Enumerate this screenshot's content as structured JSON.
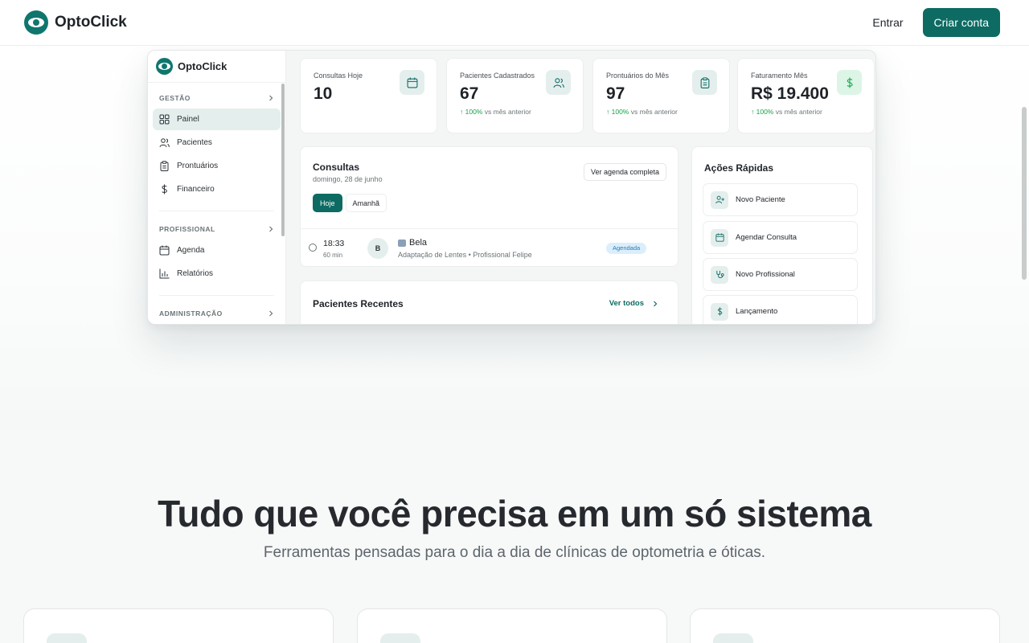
{
  "nav": {
    "brand": "OptoClick",
    "login_label": "Entrar",
    "signup_label": "Criar conta"
  },
  "app": {
    "brand": "OptoClick",
    "sidebar": {
      "sections": [
        {
          "title": "GESTÃO",
          "items": [
            {
              "label": "Painel",
              "icon": "grid-icon",
              "active": true
            },
            {
              "label": "Pacientes",
              "icon": "users-icon"
            },
            {
              "label": "Prontuários",
              "icon": "clipboard-icon"
            },
            {
              "label": "Financeiro",
              "icon": "dollar-icon"
            }
          ]
        },
        {
          "title": "PROFISSIONAL",
          "items": [
            {
              "label": "Agenda",
              "icon": "calendar-icon"
            },
            {
              "label": "Relatórios",
              "icon": "bar-chart-icon"
            }
          ]
        },
        {
          "title": "ADMINISTRAÇÃO",
          "items": []
        }
      ]
    },
    "stats": [
      {
        "label": "Consultas Hoje",
        "value": "10",
        "icon": "calendar-icon"
      },
      {
        "label": "Pacientes Cadastrados",
        "value": "67",
        "trend": "100%",
        "trend_suffix": "vs mês anterior",
        "icon": "users-icon"
      },
      {
        "label": "Prontuários do Mês",
        "value": "97",
        "trend": "100%",
        "trend_suffix": "vs mês anterior",
        "icon": "clipboard-icon"
      },
      {
        "label": "Faturamento Mês",
        "value": "R$ 19.400",
        "trend": "100%",
        "trend_suffix": "vs mês anterior",
        "icon": "dollar-icon"
      }
    ],
    "consultas": {
      "title": "Consultas",
      "date": "domingo, 28 de junho",
      "full_agenda_label": "Ver agenda completa",
      "tabs": [
        "Hoje",
        "Amanhã"
      ],
      "active_tab": "Hoje",
      "appointments": [
        {
          "time": "18:33",
          "duration": "60 min",
          "initial": "B",
          "name": "Bela",
          "description": "Adaptação de Lentes • Profissional Felipe",
          "status": "Agendada"
        }
      ]
    },
    "recent": {
      "title": "Pacientes Recentes",
      "see_all_label": "Ver todos"
    },
    "quick_actions": {
      "title": "Ações Rápidas",
      "items": [
        {
          "label": "Novo Paciente",
          "icon": "user-plus-icon"
        },
        {
          "label": "Agendar Consulta",
          "icon": "calendar-icon"
        },
        {
          "label": "Novo Profissional",
          "icon": "stethoscope-icon"
        },
        {
          "label": "Lançamento",
          "icon": "dollar-icon"
        }
      ]
    }
  },
  "features": {
    "headline": "Tudo que você precisa em um só sistema",
    "subline": "Ferramentas pensadas para o dia a dia de clínicas de optometria e óticas."
  },
  "colors": {
    "primary": "#0d6b63",
    "accent_soft": "#e4efed",
    "trend_up": "#16a34a",
    "badge_bg": "#dbeefb",
    "badge_text": "#2b7bb5"
  }
}
